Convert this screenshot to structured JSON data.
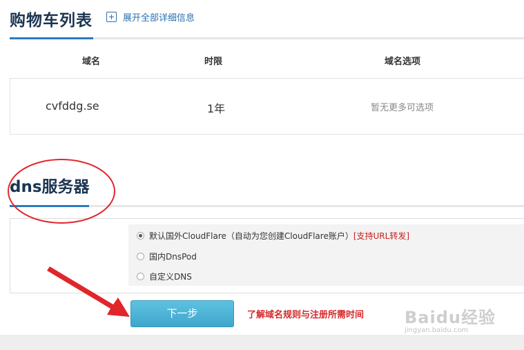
{
  "cart": {
    "title": "购物车列表",
    "expand_label": "展开全部详细信息",
    "columns": [
      "域名",
      "时限",
      "域名选项"
    ],
    "rows": [
      {
        "domain": "cvfddg.se",
        "term": "1年",
        "options": "暂无更多可选项"
      }
    ]
  },
  "dns": {
    "title": "dns服务器",
    "options": [
      {
        "label": "默认国外CloudFlare（自动为您创建CloudFlare账户）",
        "tag": "[支持URL转发]",
        "checked": true
      },
      {
        "label": "国内DnsPod",
        "tag": "",
        "checked": false
      },
      {
        "label": "自定义DNS",
        "tag": "",
        "checked": false
      }
    ]
  },
  "actions": {
    "next_label": "下一步",
    "rules_link": "了解域名规则与注册所需时间"
  },
  "watermark": {
    "brand": "Baidu经验",
    "url": "jingyan.baidu.com"
  },
  "colors": {
    "title": "#1b3551",
    "accent": "#2a7ac0",
    "link": "#2a6fb0",
    "button": "#4bb3d6",
    "alert": "#d6282a",
    "annotation": "#e0262b"
  }
}
